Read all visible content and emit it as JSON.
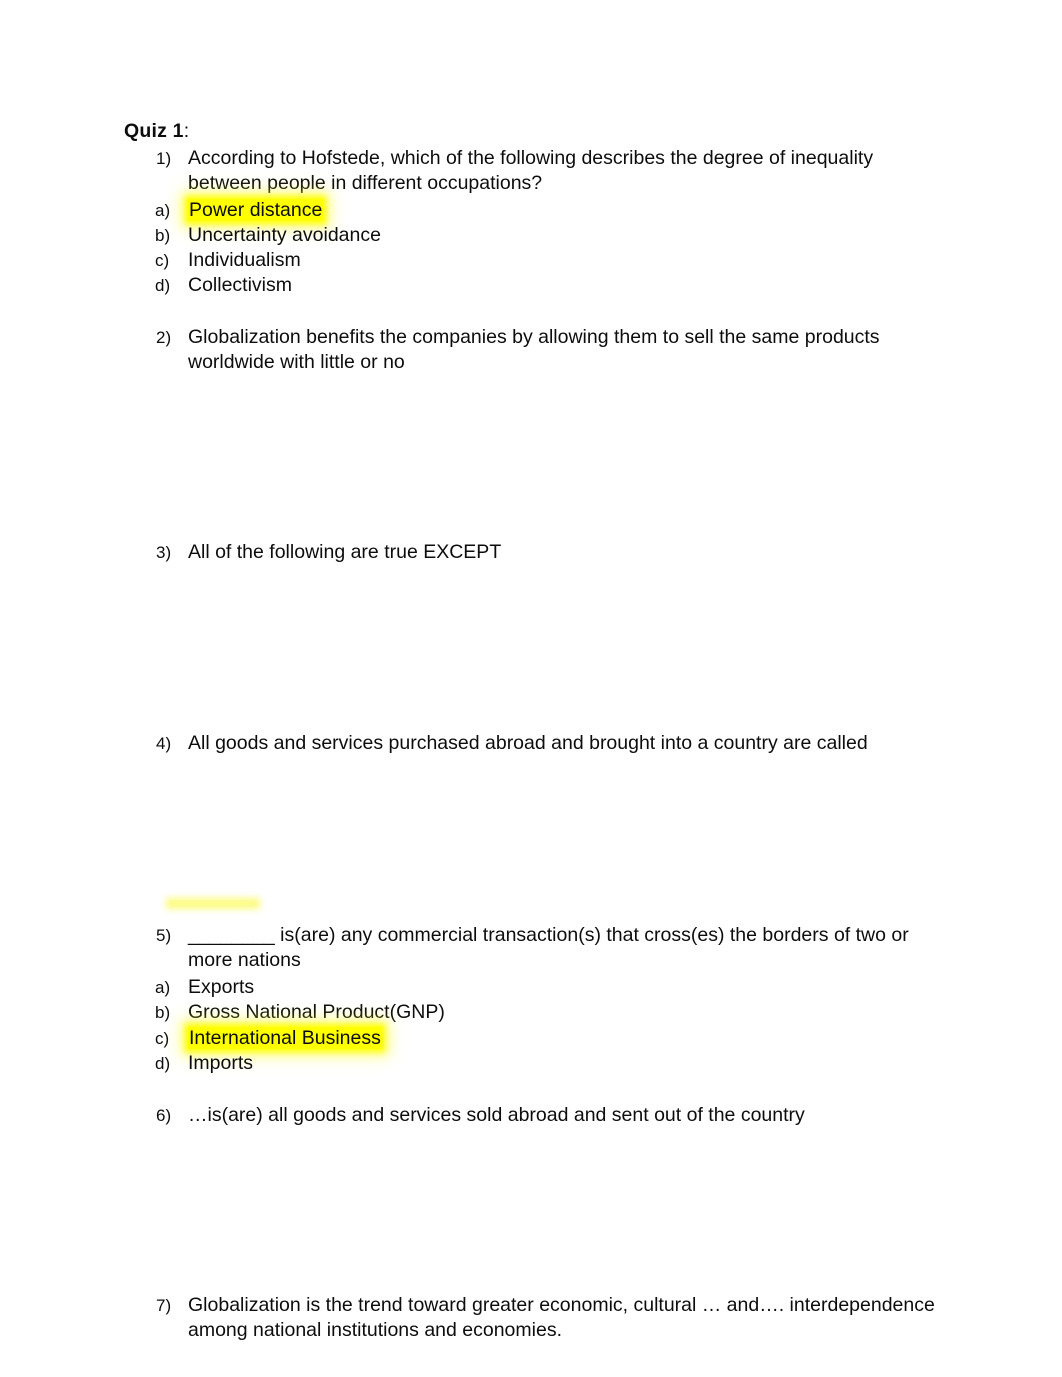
{
  "document": {
    "heading": {
      "bold_text": "Quiz 1",
      "suffix": ":"
    },
    "questions": [
      {
        "marker": "1)",
        "text": "According to Hofstede, which of the following describes the degree of inequality between people in different occupations?",
        "line1": "According to Hofstede, which of the following describes the degree of inequality",
        "line2": "between people in different occupations?",
        "options": [
          {
            "marker": "a)",
            "text": "Power distance",
            "highlighted": true
          },
          {
            "marker": "b)",
            "text": "Uncertainty avoidance",
            "highlighted": false
          },
          {
            "marker": "c)",
            "text": "Individualism",
            "highlighted": false
          },
          {
            "marker": "d)",
            "text": "Collectivism",
            "highlighted": false
          }
        ]
      },
      {
        "marker": "2)",
        "text": "Globalization benefits the companies by allowing them to sell the same products worldwide with little or no",
        "line1": "Globalization benefits the companies by allowing them to sell the same products",
        "line2": "worldwide with little or no",
        "options": []
      },
      {
        "marker": "3)",
        "text": "All of the following are true EXCEPT",
        "line1": "All of the following are true EXCEPT",
        "line2": "",
        "options": []
      },
      {
        "marker": "4)",
        "text": "All goods and services purchased abroad and brought into a country are called",
        "line1": "All goods and services purchased abroad and brought into a country are called",
        "line2": "",
        "options": []
      },
      {
        "marker": "5)",
        "text": "________ is(are) any commercial transaction(s) that cross(es) the borders of two or more nations",
        "line1_blank": "________",
        "line1": " is(are) any commercial transaction(s) that cross(es) the borders of two or more",
        "line2": "nations",
        "options": [
          {
            "marker": "a)",
            "text": "Exports",
            "highlighted": false
          },
          {
            "marker": "b)",
            "text": "Gross National Product(GNP)",
            "highlighted": false
          },
          {
            "marker": "c)",
            "text": "International Business",
            "highlighted": true
          },
          {
            "marker": "d)",
            "text": "Imports",
            "highlighted": false
          }
        ]
      },
      {
        "marker": "6)",
        "text": "…is(are) all goods and services sold abroad and sent out of the country",
        "line1": "…is(are) all goods and services sold abroad and sent out of the country",
        "line2": "",
        "options": []
      },
      {
        "marker": "7)",
        "text": "Globalization is the trend toward greater economic, cultural … and…. interdependence among national institutions and economies.",
        "line1": "Globalization is the trend toward greater economic, cultural … and…. interdependence",
        "line2": "among national institutions and economies.",
        "options": []
      }
    ],
    "colors": {
      "highlight": "#ffff00",
      "text": "#0d0d0d",
      "page_background": "#ffffff"
    }
  }
}
